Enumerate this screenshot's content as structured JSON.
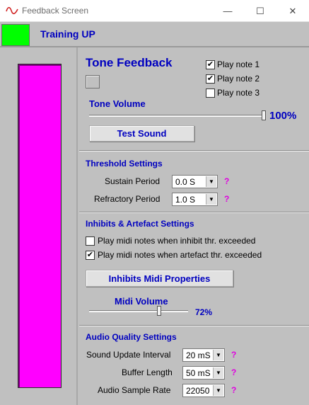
{
  "window": {
    "title": "Feedback Screen",
    "minimize": "—",
    "maximize": "☐",
    "close": "✕"
  },
  "status": {
    "title": "Training UP",
    "indicator_color": "#00ff00"
  },
  "meter": {
    "color": "#ff00ff",
    "level": 1.0
  },
  "tone": {
    "heading": "Tone Feedback",
    "notes": [
      {
        "label": "Play note 1",
        "checked": true
      },
      {
        "label": "Play note 2",
        "checked": true
      },
      {
        "label": "Play note 3",
        "checked": false
      }
    ],
    "volume_label": "Tone Volume",
    "volume_value": "100%",
    "volume_level": 1.0,
    "test_button": "Test Sound"
  },
  "threshold": {
    "heading": "Threshold Settings",
    "sustain_label": "Sustain Period",
    "sustain_value": "0.0 S",
    "refractory_label": "Refractory Period",
    "refractory_value": "1.0 S",
    "help": "?"
  },
  "inhibits": {
    "heading": "Inhibits & Artefact Settings",
    "inhibit_label": "Play midi notes when inhibit thr. exceeded",
    "inhibit_checked": false,
    "artefact_label": "Play midi notes when artefact thr. exceeded",
    "artefact_checked": true,
    "midi_button": "Inhibits Midi Properties",
    "midi_volume_label": "Midi Volume",
    "midi_volume_value": "72%",
    "midi_volume_level": 0.72
  },
  "audio": {
    "heading": "Audio Quality Settings",
    "update_label": "Sound Update Interval",
    "update_value": "20 mS",
    "buffer_label": "Buffer Length",
    "buffer_value": "50 mS",
    "rate_label": "Audio Sample Rate",
    "rate_value": "22050",
    "help": "?"
  }
}
